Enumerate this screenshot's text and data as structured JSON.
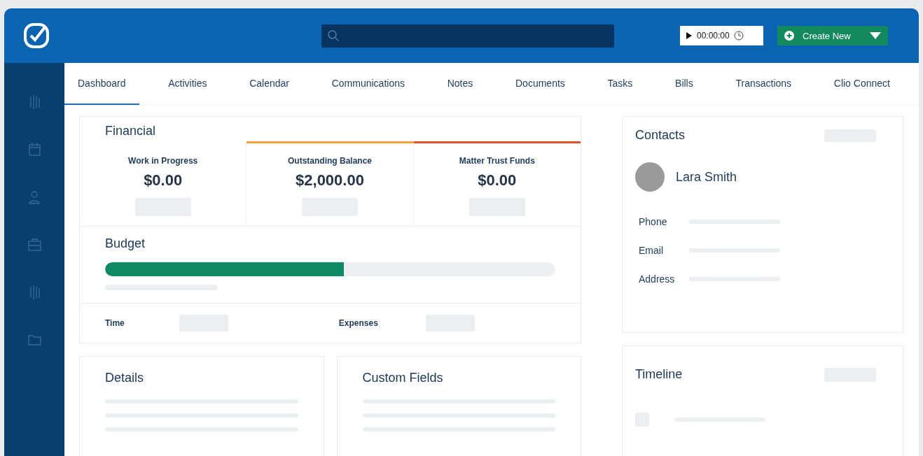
{
  "header": {
    "timer": {
      "time": "00:00:00"
    },
    "create_button": {
      "label": "Create New"
    }
  },
  "tabs": [
    {
      "label": "Dashboard",
      "selected": true
    },
    {
      "label": "Activities",
      "selected": false
    },
    {
      "label": "Calendar",
      "selected": false
    },
    {
      "label": "Communications",
      "selected": false
    },
    {
      "label": "Notes",
      "selected": false
    },
    {
      "label": "Documents",
      "selected": false
    },
    {
      "label": "Tasks",
      "selected": false
    },
    {
      "label": "Bills",
      "selected": false
    },
    {
      "label": "Transactions",
      "selected": false
    },
    {
      "label": "Clio Connect",
      "selected": false
    }
  ],
  "financial": {
    "title": "Financial",
    "metrics": [
      {
        "label": "Work in Progress",
        "amount": "$0.00"
      },
      {
        "label": "Outstanding Balance",
        "amount": "$2,000.00",
        "color": "#f5a23a"
      },
      {
        "label": "Matter Trust Funds",
        "amount": "$0.00",
        "color": "#e2532a"
      }
    ]
  },
  "budget": {
    "title": "Budget",
    "level": 0.53,
    "time_label": "Time",
    "expenses_label": "Expenses"
  },
  "details": {
    "title": "Details"
  },
  "custom_fields": {
    "title": "Custom Fields"
  },
  "contacts": {
    "title": "Contacts",
    "name": "Lara Smith",
    "fields": [
      {
        "label": "Phone"
      },
      {
        "label": "Email"
      },
      {
        "label": "Address"
      }
    ]
  },
  "timeline": {
    "title": "Timeline"
  }
}
